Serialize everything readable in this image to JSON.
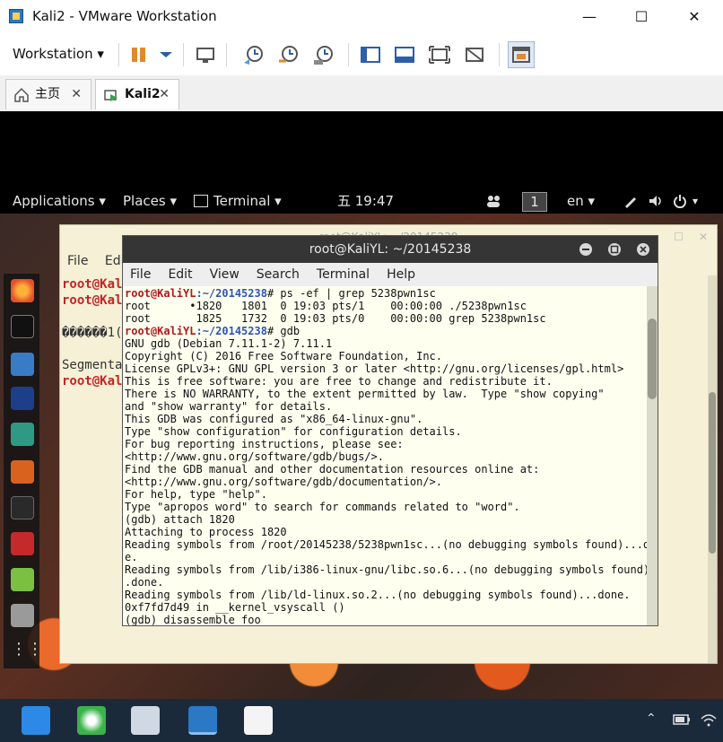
{
  "window": {
    "title": "Kali2 - VMware Workstation",
    "minimize": "—",
    "maximize": "☐",
    "close": "✕"
  },
  "toolbar": {
    "workstation_label": "Workstation",
    "dropdown_glyph": "▾"
  },
  "tabs": [
    {
      "label": "主页",
      "close": "✕"
    },
    {
      "label": "Kali2",
      "close": "✕"
    }
  ],
  "gnome": {
    "applications": "Applications ▾",
    "places": "Places ▾",
    "terminal": "Terminal ▾",
    "clock": "五 19:47",
    "workspace": "1",
    "lang": "en ▾"
  },
  "back_terminal": {
    "title": "root@KaliYL: ~/20145238",
    "menu": [
      "File",
      "Edit"
    ],
    "lines": [
      {
        "prompt": "root@Kal",
        "text": ""
      },
      {
        "prompt": "root@Kal",
        "text": ""
      },
      {
        "prompt": "",
        "text": ""
      },
      {
        "prompt": "",
        "text": "������1("
      },
      {
        "prompt": "",
        "text": ""
      },
      {
        "prompt": "",
        "text": "Segmenta"
      },
      {
        "prompt": "root@Kal",
        "text": ""
      }
    ]
  },
  "front_terminal": {
    "title": "root@KaliYL: ~/20145238",
    "menu": [
      "File",
      "Edit",
      "View",
      "Search",
      "Terminal",
      "Help"
    ],
    "lines": [
      {
        "p": "root@KaliYL",
        "d": ":~/20145238",
        "t": "# ps -ef | grep 5238pwn1sc"
      },
      {
        "p": "",
        "d": "",
        "t": "root      •1820   1801  0 19:03 pts/1    00:00:00 ./5238pwn1sc"
      },
      {
        "p": "",
        "d": "",
        "t": "root       1825   1732  0 19:03 pts/0    00:00:00 grep 5238pwn1sc"
      },
      {
        "p": "root@KaliYL",
        "d": ":~/20145238",
        "t": "# gdb"
      },
      {
        "p": "",
        "d": "",
        "t": "GNU gdb (Debian 7.11.1-2) 7.11.1"
      },
      {
        "p": "",
        "d": "",
        "t": "Copyright (C) 2016 Free Software Foundation, Inc."
      },
      {
        "p": "",
        "d": "",
        "t": "License GPLv3+: GNU GPL version 3 or later <http://gnu.org/licenses/gpl.html>"
      },
      {
        "p": "",
        "d": "",
        "t": "This is free software: you are free to change and redistribute it."
      },
      {
        "p": "",
        "d": "",
        "t": "There is NO WARRANTY, to the extent permitted by law.  Type \"show copying\""
      },
      {
        "p": "",
        "d": "",
        "t": "and \"show warranty\" for details."
      },
      {
        "p": "",
        "d": "",
        "t": "This GDB was configured as \"x86_64-linux-gnu\"."
      },
      {
        "p": "",
        "d": "",
        "t": "Type \"show configuration\" for configuration details."
      },
      {
        "p": "",
        "d": "",
        "t": "For bug reporting instructions, please see:"
      },
      {
        "p": "",
        "d": "",
        "t": "<http://www.gnu.org/software/gdb/bugs/>."
      },
      {
        "p": "",
        "d": "",
        "t": "Find the GDB manual and other documentation resources online at:"
      },
      {
        "p": "",
        "d": "",
        "t": "<http://www.gnu.org/software/gdb/documentation/>."
      },
      {
        "p": "",
        "d": "",
        "t": "For help, type \"help\"."
      },
      {
        "p": "",
        "d": "",
        "t": "Type \"apropos word\" to search for commands related to \"word\"."
      },
      {
        "p": "",
        "d": "",
        "t": "(gdb) attach 1820"
      },
      {
        "p": "",
        "d": "",
        "t": "Attaching to process 1820"
      },
      {
        "p": "",
        "d": "",
        "t": "Reading symbols from /root/20145238/5238pwn1sc...(no debugging symbols found)...don"
      },
      {
        "p": "",
        "d": "",
        "t": "e."
      },
      {
        "p": "",
        "d": "",
        "t": "Reading symbols from /lib/i386-linux-gnu/libc.so.6...(no debugging symbols found).."
      },
      {
        "p": "",
        "d": "",
        "t": ".done."
      },
      {
        "p": "",
        "d": "",
        "t": "Reading symbols from /lib/ld-linux.so.2...(no debugging symbols found)...done."
      },
      {
        "p": "",
        "d": "",
        "t": "0xf7fd7d49 in __kernel_vsyscall ()"
      },
      {
        "p": "",
        "d": "",
        "t": "(gdb) disassemble foo"
      }
    ]
  },
  "colors": {
    "prompt_red": "#b01818",
    "path_blue": "#2d55b5",
    "terminal_bg": "#fffff0"
  }
}
